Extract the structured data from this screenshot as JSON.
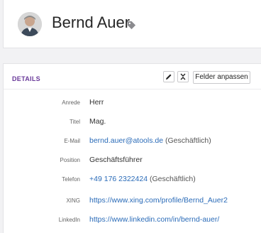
{
  "contact": {
    "name": "Bernd Auer"
  },
  "details": {
    "section_title": "DETAILS",
    "customize_fields_label": "Felder anpassen",
    "fields": {
      "salutation": {
        "label": "Anrede",
        "value": "Herr"
      },
      "title": {
        "label": "Titel",
        "value": "Mag."
      },
      "email": {
        "label": "E-Mail",
        "value": "bernd.auer@atools.de",
        "type": "(Geschäftlich)"
      },
      "position": {
        "label": "Position",
        "value": "Geschäftsführer"
      },
      "phone": {
        "label": "Telefon",
        "value": "+49 176 2322424",
        "type": "(Geschäftlich)"
      },
      "xing": {
        "label": "XING",
        "value": "https://www.xing.com/profile/Bernd_Auer2"
      },
      "linkedin": {
        "label": "LinkedIn",
        "value": "https://www.linkedin.com/in/bernd-auer/"
      }
    }
  },
  "icons": {
    "tag": "tag-icon",
    "edit": "pencil-icon",
    "collapse": "collapse-icon"
  },
  "colors": {
    "accent": "#6a3a9a",
    "link": "#2a6bb8",
    "background": "#f2f2f4"
  }
}
